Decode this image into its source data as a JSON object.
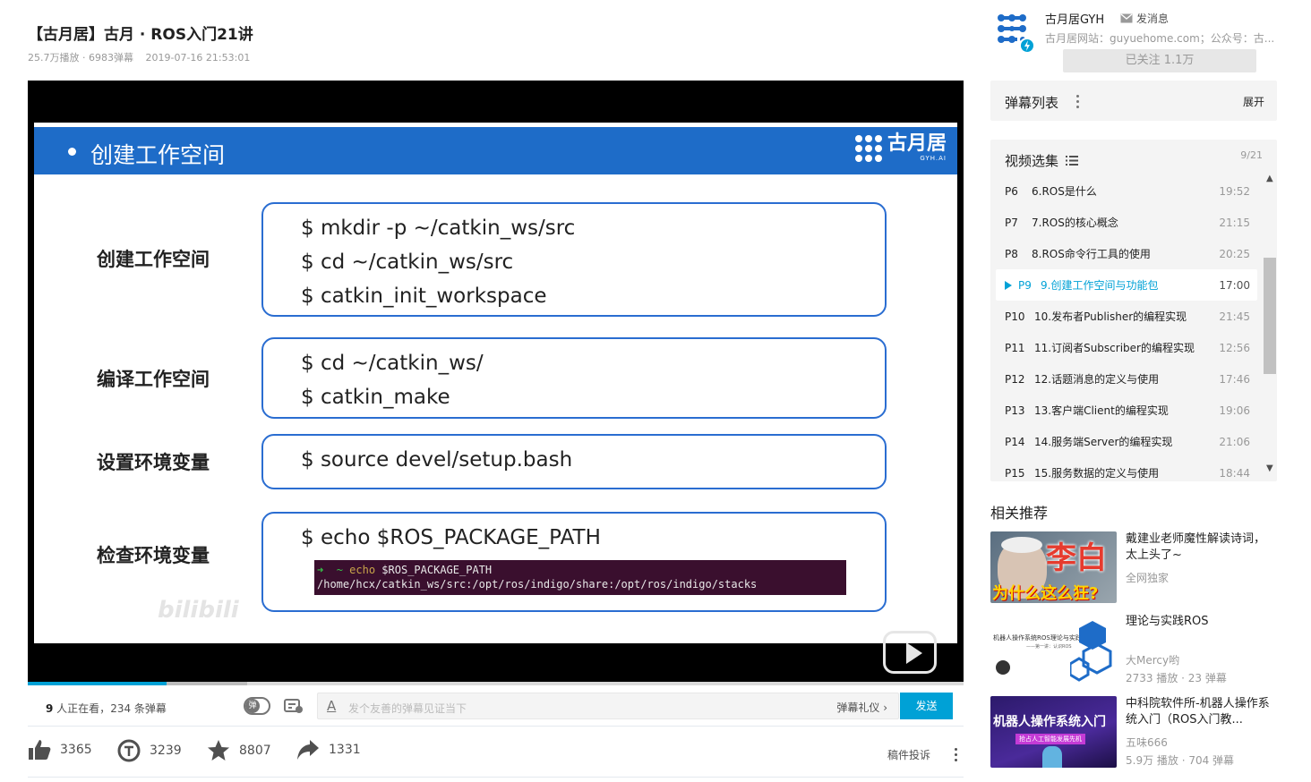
{
  "video": {
    "title": "【古月居】古月 · ROS入门21讲",
    "views": "25.7万播放 · 6983弹幕",
    "date": "2019-07-16 21:53:01"
  },
  "slide": {
    "heading": "创建工作空间",
    "logo_text": "古月居",
    "logo_sub": "GYH.AI",
    "rows": [
      {
        "label": "创建工作空间",
        "lines": [
          "$ mkdir -p ~/catkin_ws/src",
          "$ cd ~/catkin_ws/src",
          "$ catkin_init_workspace"
        ]
      },
      {
        "label": "编译工作空间",
        "lines": [
          "$ cd ~/catkin_ws/",
          "$ catkin_make"
        ]
      },
      {
        "label": "设置环境变量",
        "lines": [
          "$ source devel/setup.bash"
        ]
      },
      {
        "label": "检查环境变量",
        "lines": [
          "$ echo $ROS_PACKAGE_PATH"
        ]
      }
    ],
    "terminal": {
      "arrow": "➜",
      "tilde": "~",
      "cmd": "echo",
      "arg": "$ROS_PACKAGE_PATH",
      "output": "/home/hcx/catkin_ws/src:/opt/ros/indigo/share:/opt/ros/indigo/stacks"
    },
    "watermark": "bilibili"
  },
  "player": {
    "progress": 0.148,
    "viewers_count": "9",
    "viewers_text": " 人正在看，",
    "danmaku_count": "234",
    "danmaku_text": " 条弹幕",
    "toggle_label": "弹",
    "input_placeholder": "发个友善的弹幕见证当下",
    "etiquette": "弹幕礼仪 ›",
    "send": "发送"
  },
  "actions": {
    "like": "3365",
    "coin": "3239",
    "favorite": "8807",
    "share": "1331",
    "report": "稿件投诉"
  },
  "uploader": {
    "name": "古月居GYH",
    "message": "发消息",
    "desc": "古月居网站：guyuehome.com；公众号：古...",
    "follow": "已关注 1.1万"
  },
  "danmaku_list": {
    "title": "弹幕列表",
    "expand": "展开"
  },
  "episodes": {
    "title": "视频选集",
    "count": "9/21",
    "items": [
      {
        "p": "P6",
        "name": "6.ROS是什么",
        "dur": "19:52",
        "active": false
      },
      {
        "p": "P7",
        "name": "7.ROS的核心概念",
        "dur": "21:15",
        "active": false
      },
      {
        "p": "P8",
        "name": "8.ROS命令行工具的使用",
        "dur": "20:25",
        "active": false
      },
      {
        "p": "P9",
        "name": "9.创建工作空间与功能包",
        "dur": "17:00",
        "active": true
      },
      {
        "p": "P10",
        "name": "10.发布者Publisher的编程实现",
        "dur": "21:45",
        "active": false
      },
      {
        "p": "P11",
        "name": "11.订阅者Subscriber的编程实现",
        "dur": "12:56",
        "active": false
      },
      {
        "p": "P12",
        "name": "12.话题消息的定义与使用",
        "dur": "17:46",
        "active": false
      },
      {
        "p": "P13",
        "name": "13.客户端Client的编程实现",
        "dur": "19:06",
        "active": false
      },
      {
        "p": "P14",
        "name": "14.服务端Server的编程实现",
        "dur": "21:06",
        "active": false
      },
      {
        "p": "P15",
        "name": "15.服务数据的定义与使用",
        "dur": "18:44",
        "active": false
      }
    ]
  },
  "related": {
    "title": "相关推荐",
    "items": [
      {
        "title": "戴建业老师魔性解读诗词，太上头了~",
        "author": "全网独家",
        "stats": "",
        "thumb_text": "李白",
        "thumb_sub": "为什么这么狂?"
      },
      {
        "title": "理论与实践ROS",
        "author": "大Mercy哟",
        "stats": "2733 播放 · 23 弹幕",
        "thumb_text": "机器人操作系统ROS理论与实践",
        "thumb_sub": "——第一讲：认识ROS"
      },
      {
        "title": "中科院软件所-机器人操作系统入门（ROS入门教...",
        "author": "五味666",
        "stats": "5.9万 播放 · 704 弹幕",
        "thumb_text": "机器人操作系统入门",
        "thumb_sub": "抢占人工智能发展先机"
      }
    ]
  },
  "colors": {
    "accent": "#00a1d6",
    "slide_blue": "#1e6cc8",
    "terminal_bg": "#3a0f2e"
  }
}
